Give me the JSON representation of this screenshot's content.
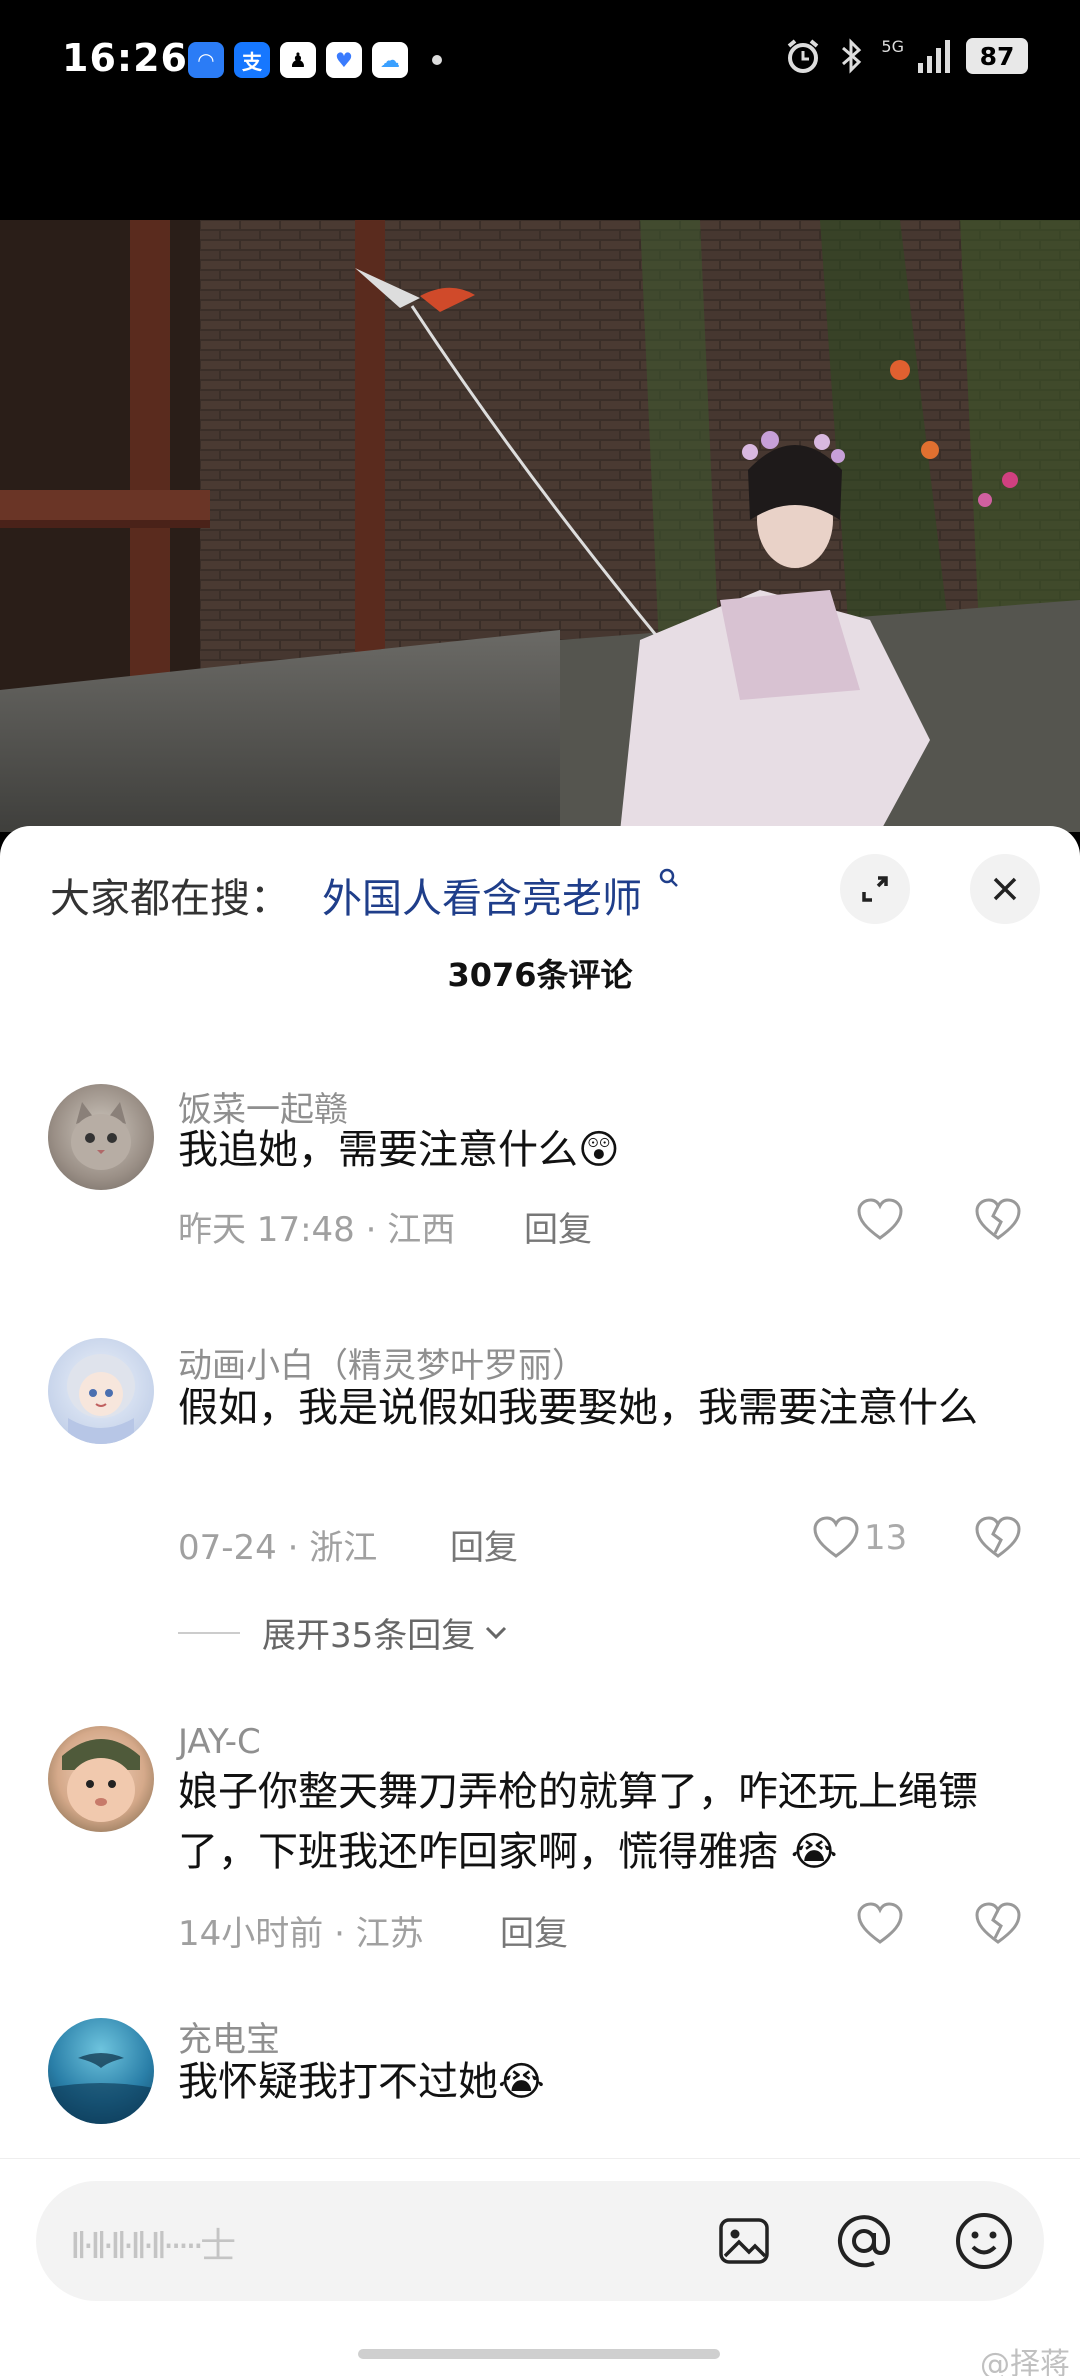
{
  "status_bar": {
    "time": "16:26",
    "apps": [
      {
        "icon": "browser-icon",
        "color": "#2b7cf6",
        "glyph": "◠"
      },
      {
        "icon": "alipay-icon",
        "color": "#1677ff",
        "glyph": "支"
      },
      {
        "icon": "qq-icon",
        "color": "#111111",
        "glyph": "♟"
      },
      {
        "icon": "health-icon",
        "color": "#3a7bfd",
        "glyph": "♥"
      },
      {
        "icon": "cloud-icon",
        "color": "#3aa0ff",
        "glyph": "☁"
      }
    ],
    "network": "5G",
    "battery": "87"
  },
  "colors": {
    "accent_blue": "#1f3e8a",
    "text_primary": "#111111",
    "text_secondary": "#8f8f8f"
  },
  "sheet": {
    "search_prefix": "大家都在搜：",
    "search_term": "外国人看含亮老师",
    "comment_count": "3076条评论"
  },
  "comments": [
    {
      "username": "饭菜一起赣",
      "text": "我追她，需要注意什么",
      "emoji": "😲",
      "time": "昨天 17:48",
      "location": "江西",
      "reply": "回复",
      "likes": ""
    },
    {
      "username": "动画小白（精灵梦叶罗丽）",
      "text": "假如，我是说假如我要娶她，我需要注意什么",
      "time": "07-24",
      "location": "浙江",
      "reply": "回复",
      "likes": "13"
    },
    {
      "username": "JAY-C",
      "text": "娘子你整天舞刀弄枪的就算了，咋还玩上绳镖了，下班我还咋回家啊，慌得雅痞",
      "emoji": "😭",
      "time": "14小时前",
      "location": "江苏",
      "reply": "回复",
      "likes": ""
    },
    {
      "username": "充电宝",
      "text": "我怀疑我打不过她",
      "emoji": "😭",
      "time": "",
      "location": "",
      "reply": "",
      "likes": ""
    }
  ],
  "expand_replies": "展开35条回复",
  "input": {
    "placeholder": "Il·Il·Il·Il·Il·····士"
  },
  "watermark": "@择蒋"
}
